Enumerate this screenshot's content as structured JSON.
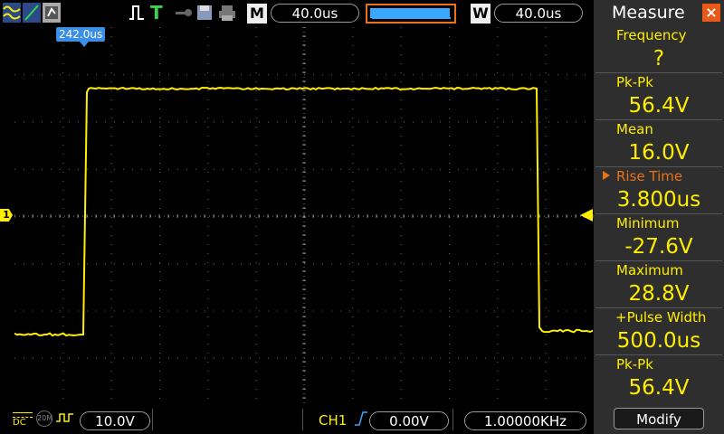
{
  "topbar": {
    "timebase": "40.0us",
    "window_timebase": "40.0us",
    "main_label": "M",
    "window_label": "W",
    "trigger_status": "T"
  },
  "scope": {
    "trigger_position": "242.0us",
    "channel_marker": "1",
    "trace_color": "#ffee00"
  },
  "measure": {
    "title": "Measure",
    "close_icon": "×",
    "rows": [
      {
        "label": "Frequency",
        "value": "?"
      },
      {
        "label": "Pk-Pk",
        "value": "56.4V"
      },
      {
        "label": "Mean",
        "value": "16.0V"
      },
      {
        "label": "Rise Time",
        "value": "3.800us",
        "selected": true
      },
      {
        "label": "Minimum",
        "value": "-27.6V"
      },
      {
        "label": "Maximum",
        "value": "28.8V"
      },
      {
        "label": "+Pulse Width",
        "value": "500.0us"
      },
      {
        "label": "Pk-Pk",
        "value": "56.4V"
      }
    ],
    "modify_label": "Modify"
  },
  "bottombar": {
    "coupling": "DC",
    "bw_limit": "20M",
    "volts_div": "10.0V",
    "trigger_source": "CH1",
    "trigger_level": "0.00V",
    "frequency": "1.00000KHz"
  }
}
